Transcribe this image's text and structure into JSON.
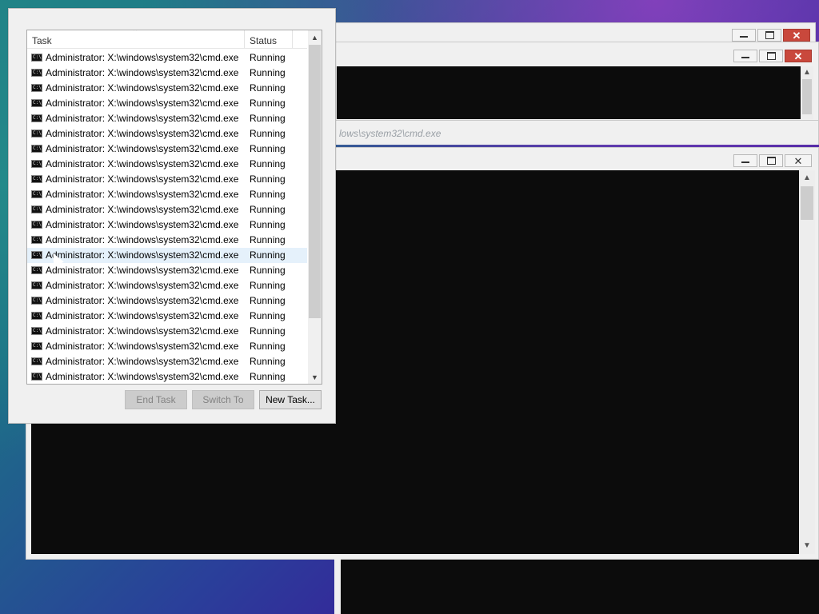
{
  "dialog": {
    "columns": {
      "task": "Task",
      "status": "Status"
    },
    "tasks": [
      {
        "name": "Administrator: X:\\windows\\system32\\cmd.exe",
        "status": "Running"
      },
      {
        "name": "Administrator: X:\\windows\\system32\\cmd.exe",
        "status": "Running"
      },
      {
        "name": "Administrator: X:\\windows\\system32\\cmd.exe",
        "status": "Running"
      },
      {
        "name": "Administrator: X:\\windows\\system32\\cmd.exe",
        "status": "Running"
      },
      {
        "name": "Administrator: X:\\windows\\system32\\cmd.exe",
        "status": "Running"
      },
      {
        "name": "Administrator: X:\\windows\\system32\\cmd.exe",
        "status": "Running"
      },
      {
        "name": "Administrator: X:\\windows\\system32\\cmd.exe",
        "status": "Running"
      },
      {
        "name": "Administrator: X:\\windows\\system32\\cmd.exe",
        "status": "Running"
      },
      {
        "name": "Administrator: X:\\windows\\system32\\cmd.exe",
        "status": "Running"
      },
      {
        "name": "Administrator: X:\\windows\\system32\\cmd.exe",
        "status": "Running"
      },
      {
        "name": "Administrator: X:\\windows\\system32\\cmd.exe",
        "status": "Running"
      },
      {
        "name": "Administrator: X:\\windows\\system32\\cmd.exe",
        "status": "Running"
      },
      {
        "name": "Administrator: X:\\windows\\system32\\cmd.exe",
        "status": "Running"
      },
      {
        "name": "Administrator: X:\\windows\\system32\\cmd.exe",
        "status": "Running",
        "highlighted": true
      },
      {
        "name": "Administrator: X:\\windows\\system32\\cmd.exe",
        "status": "Running"
      },
      {
        "name": "Administrator: X:\\windows\\system32\\cmd.exe",
        "status": "Running"
      },
      {
        "name": "Administrator: X:\\windows\\system32\\cmd.exe",
        "status": "Running"
      },
      {
        "name": "Administrator: X:\\windows\\system32\\cmd.exe",
        "status": "Running"
      },
      {
        "name": "Administrator: X:\\windows\\system32\\cmd.exe",
        "status": "Running"
      },
      {
        "name": "Administrator: X:\\windows\\system32\\cmd.exe",
        "status": "Running"
      },
      {
        "name": "Administrator: X:\\windows\\system32\\cmd.exe",
        "status": "Running"
      },
      {
        "name": "Administrator: X:\\windows\\system32\\cmd.exe",
        "status": "Running"
      }
    ],
    "buttons": {
      "end_task": "End Task",
      "switch_to": "Switch To",
      "new_task": "New Task..."
    }
  },
  "background": {
    "partial_title": "lows\\system32\\cmd.exe"
  },
  "icons": {
    "task_icon": "cmd-icon",
    "minimize": "minimize-icon",
    "maximize": "maximize-icon",
    "close": "close-icon"
  },
  "colors": {
    "console_bg": "#0c0c0c",
    "close_button": "#c9483c",
    "row_highlight": "#e5f1fb"
  }
}
